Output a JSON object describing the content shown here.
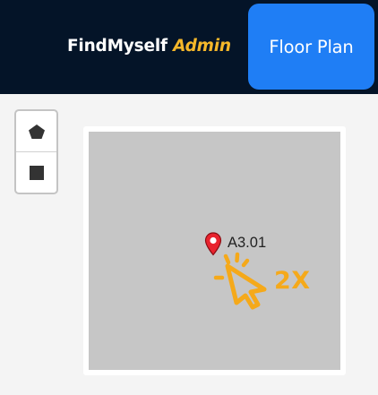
{
  "header": {
    "brand_name": "FindMyself",
    "brand_suffix": "Admin",
    "floor_plan_button": "Floor Plan"
  },
  "toolbar": {
    "tools": [
      {
        "name": "draw-polygon",
        "icon": "pentagon-icon"
      },
      {
        "name": "draw-rectangle",
        "icon": "square-icon"
      }
    ]
  },
  "map": {
    "marker_label": "A3.01",
    "marker_icon": "map-pin-icon",
    "marker_color": "#e8232e",
    "hint_icon": "double-click-cursor-icon",
    "hint_text": "2X",
    "hint_color": "#f5a91a"
  },
  "colors": {
    "header_bg": "#041428",
    "accent": "#f5b72a",
    "button_bg": "#1f7ef5",
    "map_bg": "#c6c6c6"
  }
}
